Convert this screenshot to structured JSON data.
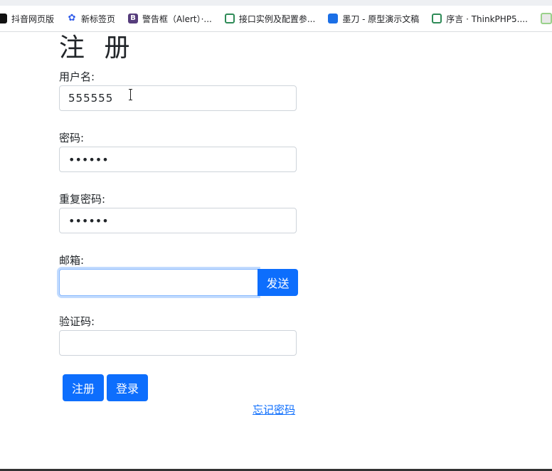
{
  "bookmarks": [
    {
      "label": "抖音网页版",
      "icon": "tiktok-icon"
    },
    {
      "label": "新标签页",
      "icon": "baidu-paw-icon"
    },
    {
      "label": "警告框（Alert）·...",
      "icon": "bootstrap-icon"
    },
    {
      "label": "接口实例及配置参...",
      "icon": "leaf-icon"
    },
    {
      "label": "墨刀 - 原型演示文稿",
      "icon": "modao-icon"
    },
    {
      "label": "序言 · ThinkPHP5....",
      "icon": "leaf-icon"
    }
  ],
  "form": {
    "title": "注 册",
    "username_label": "用户名:",
    "username_value": "555555",
    "password_label": "密码:",
    "password_value": "••••••",
    "confirm_label": "重复密码:",
    "confirm_value": "••••••",
    "email_label": "邮箱:",
    "email_value": "",
    "send_label": "发送",
    "code_label": "验证码:",
    "code_value": "",
    "register_label": "注册",
    "login_label": "登录",
    "forgot_label": "忘记密码"
  },
  "colors": {
    "primary": "#0d6efd",
    "focus_ring": "#86b7fe",
    "input_border": "#ced4da"
  }
}
